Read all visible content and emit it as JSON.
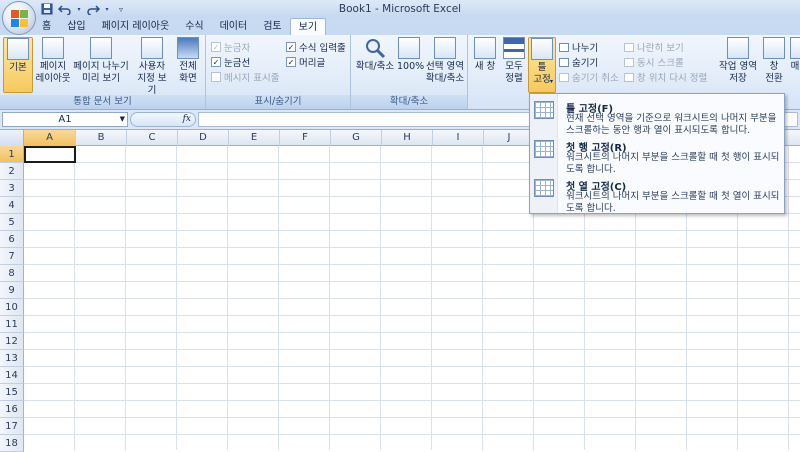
{
  "window": {
    "title": "Book1 - Microsoft Excel"
  },
  "quick_access": {
    "items": [
      "save-icon",
      "undo-icon",
      "redo-icon",
      "customize-icon"
    ]
  },
  "tabs": [
    "홈",
    "삽입",
    "페이지 레이아웃",
    "수식",
    "데이터",
    "검토",
    "보기"
  ],
  "active_tab": "보기",
  "ribbon": {
    "workbook_views": {
      "label": "통합 문서 보기",
      "normal": "기본",
      "page_layout_1": "페이지",
      "page_layout_2": "레이아웃",
      "page_break_1": "페이지 나누기",
      "page_break_2": "미리 보기",
      "custom_views_1": "사용자",
      "custom_views_2": "지정 보기",
      "full_screen_1": "전체",
      "full_screen_2": "화면"
    },
    "show_hide": {
      "label": "표시/숨기기",
      "ruler": "눈금자",
      "gridlines": "눈금선",
      "message_bar": "메시지 표시줄",
      "formula_bar": "수식 입력줄",
      "headings": "머리글",
      "ruler_checked": true,
      "gridlines_checked": true,
      "message_bar_checked": false,
      "formula_bar_checked": true,
      "headings_checked": true
    },
    "zoom": {
      "label": "확대/축소",
      "zoom": "확대/축소",
      "zoom_100": "100%",
      "zoom_selection_1": "선택 영역",
      "zoom_selection_2": "확대/축소"
    },
    "window": {
      "new_window": "새 창",
      "arrange_all_1": "모두",
      "arrange_all_2": "정렬",
      "freeze_panes_1": "틀",
      "freeze_panes_2": "고정",
      "split": "나누기",
      "hide": "숨기기",
      "unhide": "숨기기 취소",
      "side_by_side": "나란히 보기",
      "sync_scroll": "동시 스크롤",
      "reset_position": "창 위치 다시 정렬",
      "save_workspace_1": "작업 영역",
      "save_workspace_2": "저장",
      "switch_windows_1": "창",
      "switch_windows_2": "전환",
      "overflow": "매"
    }
  },
  "formula_bar": {
    "name_box": "A1",
    "fx": "fx",
    "value": ""
  },
  "sheet": {
    "columns": [
      "A",
      "B",
      "C",
      "D",
      "E",
      "F",
      "G",
      "H",
      "I",
      "J"
    ],
    "rows": [
      "1",
      "2",
      "3",
      "4",
      "5",
      "6",
      "7",
      "8",
      "9",
      "10",
      "11",
      "12",
      "13",
      "14",
      "15",
      "16",
      "17",
      "18"
    ],
    "active_cell": "A1"
  },
  "freeze_menu": {
    "items": [
      {
        "title": "틀 고정(F)",
        "desc": "현재 선택 영역을 기준으로 워크시트의 나머지 부분을 스크롤하는 동안 행과 열이 표시되도록 합니다."
      },
      {
        "title": "첫 행 고정(R)",
        "desc": "워크시트의 나머지 부분을 스크롤할 때 첫 행이 표시되도록 합니다."
      },
      {
        "title": "첫 열 고정(C)",
        "desc": "워크시트의 나머지 부분을 스크롤할 때 첫 열이 표시되도록 합니다."
      }
    ]
  },
  "colors": {
    "ribbon_bg": "#dfeaf8",
    "active_header": "#f1c15f",
    "selected_button": "#f7c95e",
    "gridline": "#d9e1ec"
  }
}
